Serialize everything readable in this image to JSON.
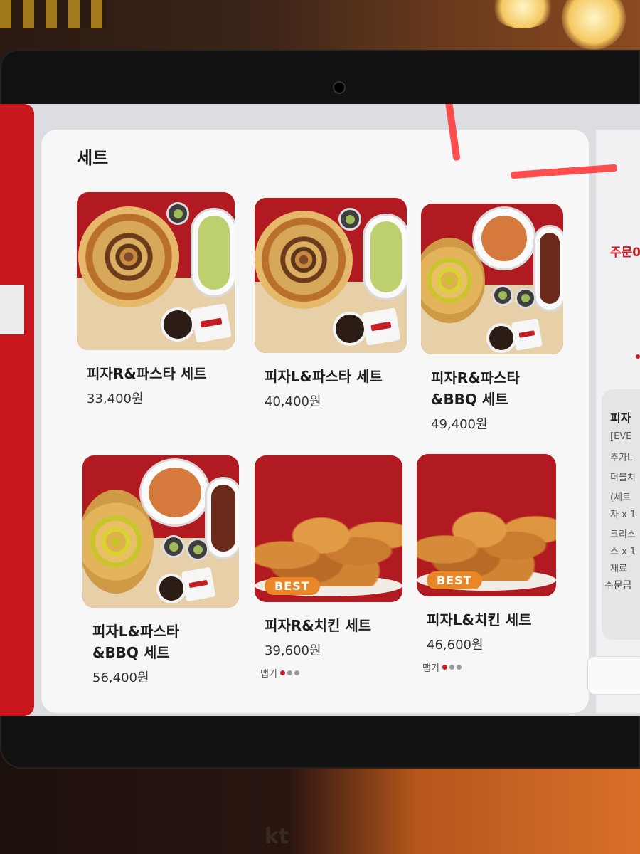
{
  "section": {
    "title": "세트"
  },
  "products": [
    {
      "name": "피자R&파스타 세트",
      "price": "33,400원"
    },
    {
      "name": "피자L&파스타 세트",
      "price": "40,400원"
    },
    {
      "name": "피자R&파스타\n&BBQ 세트",
      "price": "49,400원"
    },
    {
      "name": "피자L&파스타\n&BBQ 세트",
      "price": "56,400원"
    },
    {
      "name": "피자R&치킨 세트",
      "price": "39,600원",
      "badge": "BEST",
      "spicy_label": "맵기",
      "spicy_level": 1,
      "spicy_max": 3
    },
    {
      "name": "피자L&치킨 세트",
      "price": "46,600원",
      "badge": "BEST",
      "spicy_label": "맵기",
      "spicy_level": 1,
      "spicy_max": 3
    }
  ],
  "order_panel": {
    "title": "주문0",
    "item_name": "피자",
    "lines": [
      "[EVE",
      "추가L",
      "더블치",
      "(세트",
      "자 x 1",
      "크리스",
      "스 x 1",
      "재료"
    ],
    "total_label": "주문금"
  },
  "device": {
    "brand": "kt"
  },
  "colors": {
    "accent": "#c8161d",
    "badge": "#e98728",
    "spicy_on": "#d01d26",
    "spicy_off": "#9a9a9a"
  }
}
